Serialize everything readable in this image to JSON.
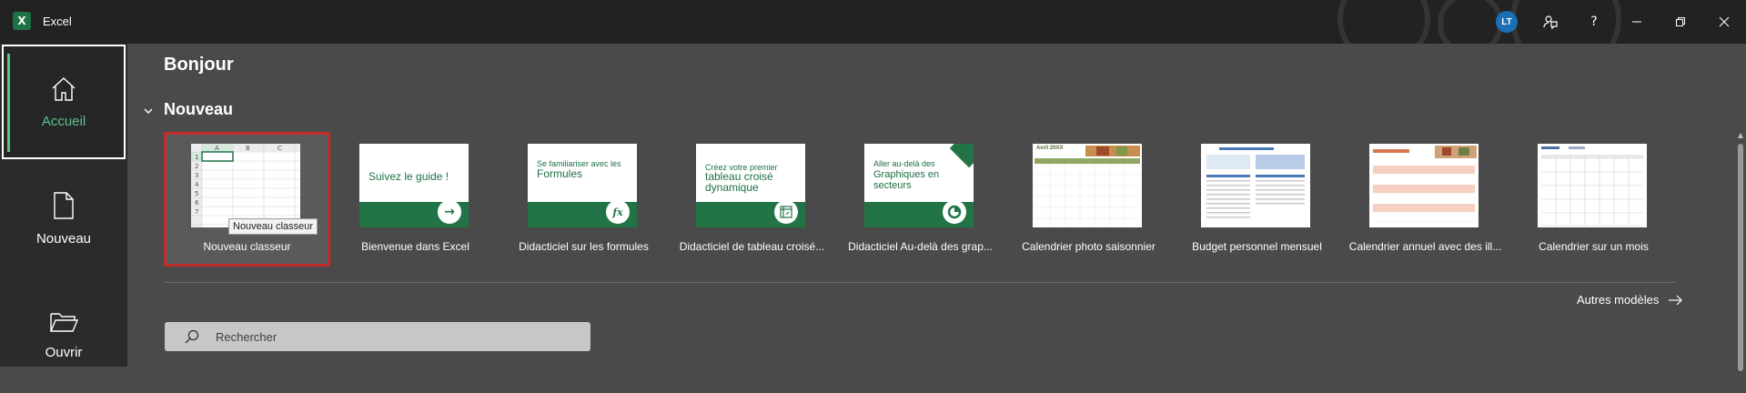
{
  "titlebar": {
    "app_name": "Excel",
    "app_icon": "excel-logo-icon",
    "user_initials": "LT"
  },
  "sidebar": {
    "items": [
      {
        "label": "Accueil",
        "icon": "home-icon",
        "active": true
      },
      {
        "label": "Nouveau",
        "icon": "new-document-icon"
      },
      {
        "label": "Ouvrir",
        "icon": "folder-open-icon"
      }
    ]
  },
  "main": {
    "greeting": "Bonjour",
    "section_title": "Nouveau",
    "templates": [
      {
        "label": "Nouveau classeur",
        "tooltip": "Nouveau classeur",
        "type": "blank"
      },
      {
        "label": "Bienvenue dans Excel",
        "tile_text": "Suivez le guide !",
        "type": "guide",
        "icon": "arrow-right-icon"
      },
      {
        "label": "Didacticiel sur les formules",
        "tile_text_small": "Se familiariser avec les",
        "tile_text": "Formules",
        "type": "formula",
        "icon": "fx-icon"
      },
      {
        "label": "Didacticiel de tableau croisé...",
        "tile_text_small": "Créez votre premier",
        "tile_text": "tableau croisé dynamique",
        "type": "pivot",
        "icon": "pivot-table-icon"
      },
      {
        "label": "Didacticiel Au-delà des grap...",
        "tile_text_small": "Aller au-delà des",
        "tile_text": "Graphiques en secteurs",
        "type": "pie",
        "icon": "pie-chart-icon"
      },
      {
        "label": "Calendrier photo saisonnier",
        "thumb_title": "Avril 20XX",
        "type": "calendar-photo"
      },
      {
        "label": "Budget personnel mensuel",
        "type": "budget"
      },
      {
        "label": "Calendrier annuel avec des ill...",
        "type": "calendar-annual"
      },
      {
        "label": "Calendrier sur un mois",
        "type": "calendar-month"
      }
    ],
    "more_templates": "Autres modèles",
    "search_placeholder": "Rechercher"
  },
  "colors": {
    "accent": "#5dc28a",
    "excel_green": "#227447",
    "selection": "#c42b2b"
  }
}
